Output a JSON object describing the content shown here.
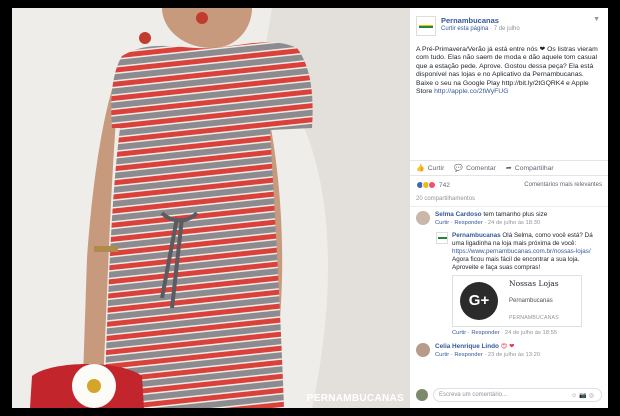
{
  "photo": {
    "watermark": "PERNAMBUCANAS"
  },
  "post": {
    "page_name": "Pernambucanas",
    "like_page": "Curtir esta página",
    "date": "7 de julho",
    "text": "A Pré-Primavera/Verão já está entre nós ❤ Os listras vieram com tudo. Elas não saem de moda e dão aquele tom casual que a estação pede. Aprove. Gostou dessa peça? Ela está disponível nas lojas e no Aplicativo da Pernambucanas. Baixe o seu na Google Play http://bit.ly/2tGQRK4 e Apple Store",
    "link": "http://apple.co/2tWyFUG"
  },
  "actions": {
    "like": "Curtir",
    "comment": "Comentar",
    "share": "Compartilhar"
  },
  "reactions": {
    "count": "742",
    "sort": "Comentários mais relevantes"
  },
  "shares": "20 compartilhamentos",
  "comments": [
    {
      "name": "Selma Cardoso",
      "text": "tem tamanho plus size",
      "meta_reply": "Curtir · Responder",
      "date": "24 de julho às 18:30"
    }
  ],
  "reply": {
    "name": "Pernambucanas",
    "text": "Olá Selma, como você está? Dá uma ligadinha na loja mais próxima de você:",
    "link": "https://www.pernambucanas.com.br/nossas-lojas/",
    "text2": "Agora ficou mais fácil de encontrar a sua loja. Aproveite e faça suas compras!",
    "card_title": "Nossas Lojas",
    "card_sub": "Pernambucanas",
    "card_domain": "PERNAMBUCANAS",
    "meta": "Curtir · Responder",
    "date": "24 de julho às 18:55"
  },
  "comment2": {
    "name": "Celia Henrique Lindo",
    "meta": "Curtir · Responder",
    "date": "23 de julho às 13:20"
  },
  "write": {
    "placeholder": "Escreva um comentário..."
  },
  "colors": {
    "link": "#365899",
    "brand_green": "#1a8a3a",
    "stripe_red": "#d9413a",
    "stripe_grey": "#8a8a8e"
  },
  "icons": {
    "gplus": "G+"
  }
}
